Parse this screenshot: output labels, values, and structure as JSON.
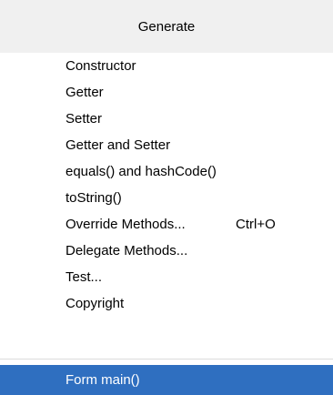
{
  "popup": {
    "title": "Generate",
    "items": [
      {
        "label": "Constructor",
        "shortcut": ""
      },
      {
        "label": "Getter",
        "shortcut": ""
      },
      {
        "label": "Setter",
        "shortcut": ""
      },
      {
        "label": "Getter and Setter",
        "shortcut": ""
      },
      {
        "label": "equals() and hashCode()",
        "shortcut": ""
      },
      {
        "label": "toString()",
        "shortcut": ""
      },
      {
        "label": "Override Methods...",
        "shortcut": "Ctrl+O"
      },
      {
        "label": "Delegate Methods...",
        "shortcut": ""
      },
      {
        "label": "Test...",
        "shortcut": ""
      },
      {
        "label": "Copyright",
        "shortcut": ""
      }
    ],
    "selected_item": {
      "label": "Form main()"
    }
  },
  "colors": {
    "header_background": "#f0f0f0",
    "selection_background": "#2f6fc0",
    "selection_text": "#ffffff",
    "separator": "#dcdcdc"
  }
}
